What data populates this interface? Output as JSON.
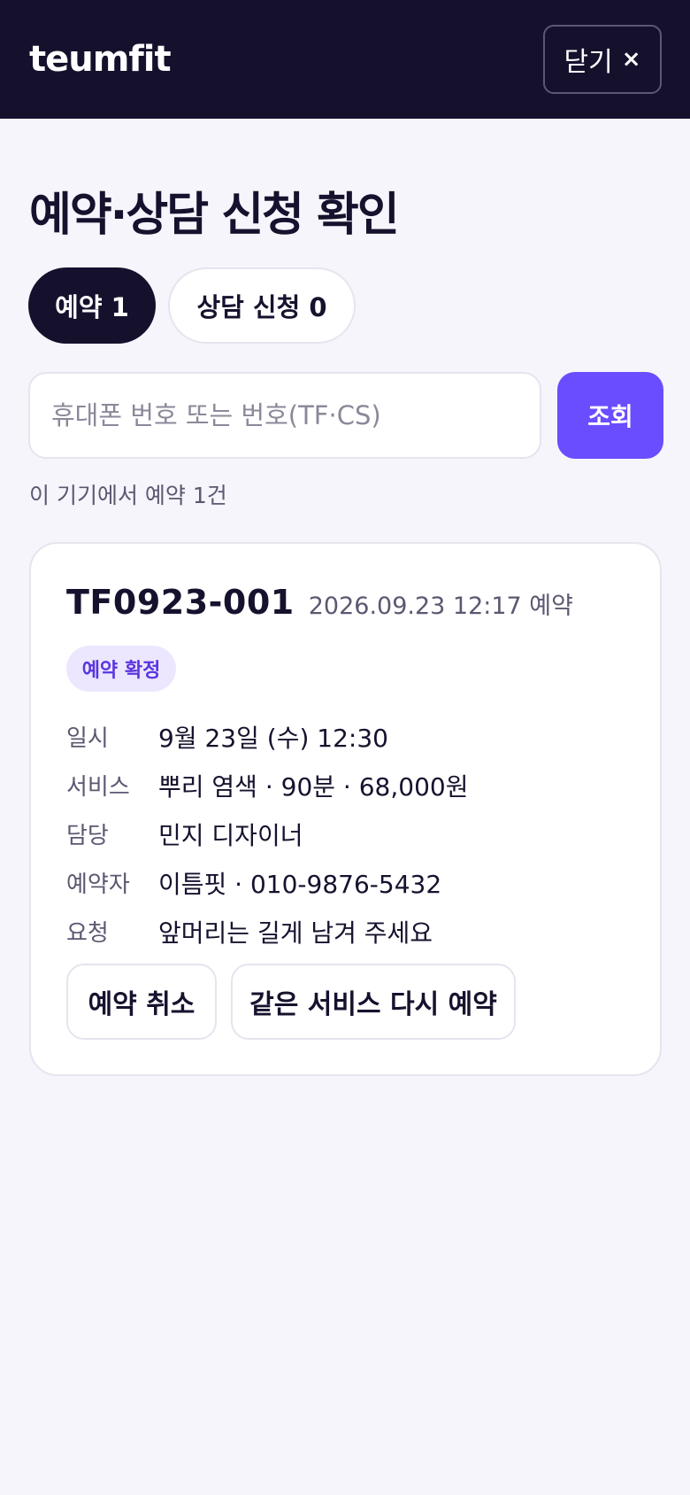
{
  "header": {
    "logo": "teumfit",
    "close_label": "닫기",
    "close_icon": "×"
  },
  "page": {
    "title": "예약·상담 신청 확인"
  },
  "tabs": [
    {
      "label": "예약 1",
      "active": true
    },
    {
      "label": "상담 신청 0",
      "active": false
    }
  ],
  "search": {
    "placeholder": "휴대폰 번호 또는 번호(TF·CS)",
    "value": "",
    "button_label": "조회"
  },
  "summary": "이 기기에서 예약 1건",
  "reservation": {
    "id": "TF0923-001",
    "created": "2026.09.23 12:17 예약",
    "status": "예약 확정",
    "rows": [
      {
        "label": "일시",
        "value": "9월 23일 (수) 12:30"
      },
      {
        "label": "서비스",
        "value": "뿌리 염색 · 90분 · 68,000원"
      },
      {
        "label": "담당",
        "value": "민지 디자이너"
      },
      {
        "label": "예약자",
        "value": "이틈핏 · 010-9876-5432"
      },
      {
        "label": "요청",
        "value": "앞머리는 길게 남겨 주세요"
      }
    ],
    "actions": {
      "cancel_label": "예약 취소",
      "rebook_label": "같은 서비스 다시 예약"
    }
  },
  "colors": {
    "header_bg": "#15112d",
    "accent": "#6a4dff",
    "badge_bg": "#ece7ff",
    "badge_text": "#5a35e0",
    "page_bg": "#f5f5fb"
  }
}
